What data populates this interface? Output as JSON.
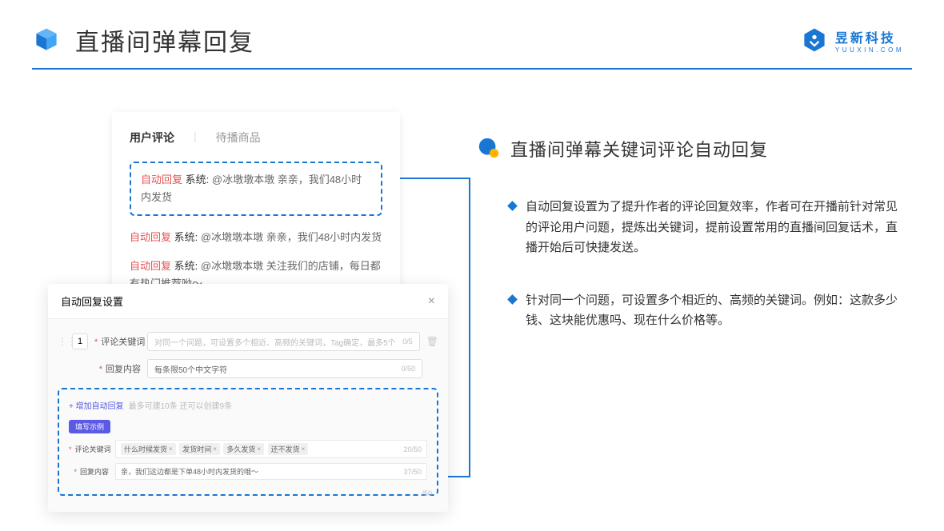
{
  "header": {
    "title": "直播间弹幕回复",
    "brand_name": "昱新科技",
    "brand_sub": "YUUXIN.COM"
  },
  "comment_card": {
    "tab_active": "用户评论",
    "tab_inactive": "待播商品",
    "reply_tag": "自动回复",
    "system_label": "系统:",
    "msg1": "@冰墩墩本墩 亲亲，我们48小时内发货",
    "msg2": "@冰墩墩本墩 亲亲，我们48小时内发货",
    "msg3": "@冰墩墩本墩 关注我们的店铺，每日都有热门推荐呦～"
  },
  "modal": {
    "title": "自动回复设置",
    "row_num": "1",
    "label_keyword": "评论关键词",
    "placeholder_keyword": "对同一个问题，可设置多个相近、高频的关键词，Tag确定，最多5个",
    "counter_keyword": "0/5",
    "label_content": "回复内容",
    "placeholder_content": "每条限50个中文字符",
    "counter_content": "0/50",
    "add_link": "+ 增加自动回复",
    "add_hint": "最多可建10条 还可以创建9条",
    "example_badge": "填写示例",
    "example_label_keyword": "评论关键词",
    "tags": [
      "什么时候发货",
      "发货时间",
      "多久发货",
      "还不发货"
    ],
    "example_counter_keyword": "20/50",
    "example_label_content": "回复内容",
    "example_content": "亲，我们这边都是下单48小时内发货的哦～",
    "example_counter_content": "37/50",
    "bottom_counter": "/50"
  },
  "right": {
    "section_title": "直播间弹幕关键词评论自动回复",
    "bullet1": "自动回复设置为了提升作者的评论回复效率，作者可在开播前针对常见的评论用户问题，提炼出关键词，提前设置常用的直播间回复话术，直播开始后可快捷发送。",
    "bullet2": "针对同一个问题，可设置多个相近的、高频的关键词。例如：这款多少钱、这块能优惠吗、现在什么价格等。"
  }
}
